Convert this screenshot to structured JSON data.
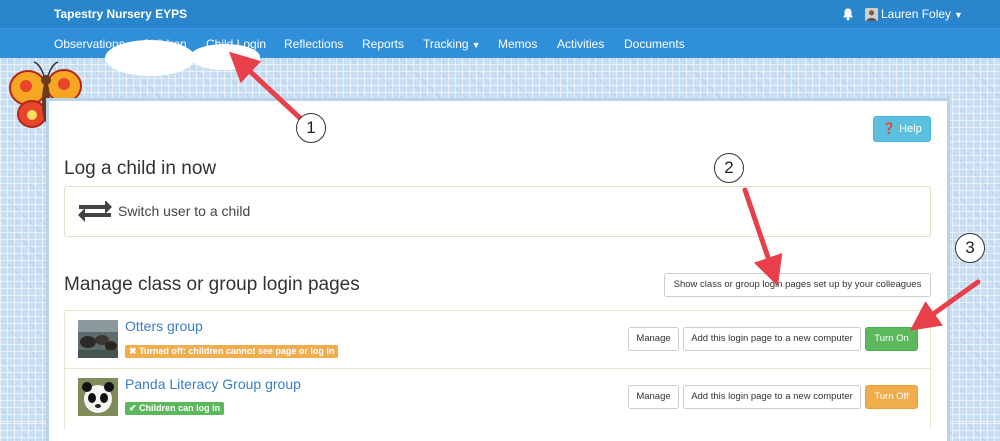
{
  "app": {
    "brand": "Tapestry Nursery EYPS",
    "user_name": "Lauren Foley"
  },
  "nav": {
    "observations": "Observations",
    "children": "Children",
    "child_login": "Child Login",
    "reflections": "Reflections",
    "reports": "Reports",
    "tracking": "Tracking",
    "memos": "Memos",
    "activities": "Activities",
    "documents": "Documents"
  },
  "help": {
    "label": "Help"
  },
  "log_section": {
    "heading": "Log a child in now",
    "switch_label": "Switch user to a child"
  },
  "manage_section": {
    "heading": "Manage class or group login pages",
    "colleagues_button": "Show class or group login pages set up by your colleagues"
  },
  "groups": [
    {
      "name": "Otters group",
      "status": "Turned off: children cannot see page or log in",
      "manage": "Manage",
      "add_computer": "Add this login page to a new computer",
      "toggle": "Turn On"
    },
    {
      "name": "Panda Literacy Group group",
      "status": "Children can log in",
      "manage": "Manage",
      "add_computer": "Add this login page to a new computer",
      "toggle": "Turn Off"
    }
  ],
  "callouts": [
    "1",
    "2",
    "3"
  ],
  "colors": {
    "topbar": "#2a86cc",
    "navbar": "#2f8fd8",
    "help": "#5bc0de",
    "link": "#3a7ec8",
    "success": "#5cb85c",
    "warning": "#f0ad4e",
    "arrow": "#e8404a"
  },
  "icons": {
    "bell": "bell-icon",
    "user": "user-avatar-icon",
    "help": "question-circle-icon",
    "switch": "exchange-arrows-icon",
    "off": "times-icon",
    "on": "check-icon",
    "butterfly": "butterfly-icon"
  }
}
